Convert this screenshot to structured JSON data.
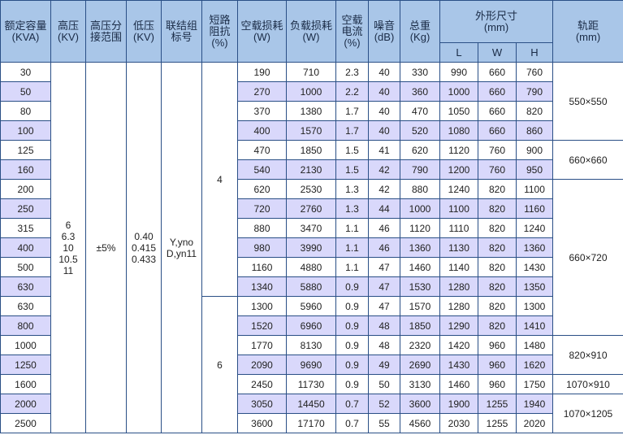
{
  "headers": {
    "capacity": "额定容量\n(KVA)",
    "hv": "高压\n(KV)",
    "tap_range": "高压分\n接范围",
    "lv": "低压\n(KV)",
    "vector_group": "联结组\n标号",
    "impedance": "短路\n阻抗\n(%)",
    "no_load_loss": "空载损耗\n(W)",
    "load_loss": "负载损耗\n(W)",
    "no_load_current": "空载\n电流\n(%)",
    "noise": "噪音\n(dB)",
    "weight": "总重\n(Kg)",
    "dims": "外形尺寸\n(mm)",
    "dim_l": "L",
    "dim_w": "W",
    "dim_h": "H",
    "gauge": "轨距\n(mm)"
  },
  "merged": {
    "hv": "6\n6.3\n10\n10.5\n11",
    "tap_range": "±5%",
    "lv": "0.40\n0.415\n0.433",
    "vector_group": "Y,yno\nD,yn11",
    "impedance_1": "4",
    "impedance_2": "6",
    "gauge_1": "550×550",
    "gauge_2": "660×660",
    "gauge_3": "660×720",
    "gauge_4": "820×910",
    "gauge_5": "1070×910",
    "gauge_6": "1070×1205"
  },
  "rows": [
    {
      "capacity": "30",
      "p0": "190",
      "pk": "710",
      "i0": "2.3",
      "noise": "40",
      "weight": "330",
      "l": "990",
      "w": "660",
      "h": "760"
    },
    {
      "capacity": "50",
      "p0": "270",
      "pk": "1000",
      "i0": "2.2",
      "noise": "40",
      "weight": "360",
      "l": "1000",
      "w": "660",
      "h": "790"
    },
    {
      "capacity": "80",
      "p0": "370",
      "pk": "1380",
      "i0": "1.7",
      "noise": "40",
      "weight": "470",
      "l": "1050",
      "w": "660",
      "h": "820"
    },
    {
      "capacity": "100",
      "p0": "400",
      "pk": "1570",
      "i0": "1.7",
      "noise": "40",
      "weight": "520",
      "l": "1080",
      "w": "660",
      "h": "860"
    },
    {
      "capacity": "125",
      "p0": "470",
      "pk": "1850",
      "i0": "1.5",
      "noise": "41",
      "weight": "620",
      "l": "1120",
      "w": "760",
      "h": "900"
    },
    {
      "capacity": "160",
      "p0": "540",
      "pk": "2130",
      "i0": "1.5",
      "noise": "42",
      "weight": "790",
      "l": "1200",
      "w": "760",
      "h": "950"
    },
    {
      "capacity": "200",
      "p0": "620",
      "pk": "2530",
      "i0": "1.3",
      "noise": "42",
      "weight": "880",
      "l": "1240",
      "w": "820",
      "h": "1100"
    },
    {
      "capacity": "250",
      "p0": "720",
      "pk": "2760",
      "i0": "1.3",
      "noise": "44",
      "weight": "1000",
      "l": "1100",
      "w": "820",
      "h": "1160"
    },
    {
      "capacity": "315",
      "p0": "880",
      "pk": "3470",
      "i0": "1.1",
      "noise": "46",
      "weight": "1120",
      "l": "1110",
      "w": "820",
      "h": "1240"
    },
    {
      "capacity": "400",
      "p0": "980",
      "pk": "3990",
      "i0": "1.1",
      "noise": "46",
      "weight": "1360",
      "l": "1130",
      "w": "820",
      "h": "1360"
    },
    {
      "capacity": "500",
      "p0": "1160",
      "pk": "4880",
      "i0": "1.1",
      "noise": "47",
      "weight": "1460",
      "l": "1140",
      "w": "820",
      "h": "1430"
    },
    {
      "capacity": "630",
      "p0": "1340",
      "pk": "5880",
      "i0": "0.9",
      "noise": "47",
      "weight": "1530",
      "l": "1280",
      "w": "820",
      "h": "1350"
    },
    {
      "capacity": "630",
      "p0": "1300",
      "pk": "5960",
      "i0": "0.9",
      "noise": "47",
      "weight": "1570",
      "l": "1280",
      "w": "820",
      "h": "1300"
    },
    {
      "capacity": "800",
      "p0": "1520",
      "pk": "6960",
      "i0": "0.9",
      "noise": "48",
      "weight": "1850",
      "l": "1290",
      "w": "820",
      "h": "1410"
    },
    {
      "capacity": "1000",
      "p0": "1770",
      "pk": "8130",
      "i0": "0.9",
      "noise": "48",
      "weight": "2320",
      "l": "1420",
      "w": "960",
      "h": "1480"
    },
    {
      "capacity": "1250",
      "p0": "2090",
      "pk": "9690",
      "i0": "0.9",
      "noise": "49",
      "weight": "2690",
      "l": "1430",
      "w": "960",
      "h": "1620"
    },
    {
      "capacity": "1600",
      "p0": "2450",
      "pk": "11730",
      "i0": "0.9",
      "noise": "50",
      "weight": "3130",
      "l": "1460",
      "w": "960",
      "h": "1750"
    },
    {
      "capacity": "2000",
      "p0": "3050",
      "pk": "14450",
      "i0": "0.7",
      "noise": "52",
      "weight": "3600",
      "l": "1900",
      "w": "1255",
      "h": "1940"
    },
    {
      "capacity": "2500",
      "p0": "3600",
      "pk": "17170",
      "i0": "0.7",
      "noise": "55",
      "weight": "4560",
      "l": "2030",
      "w": "1255",
      "h": "2020"
    }
  ]
}
